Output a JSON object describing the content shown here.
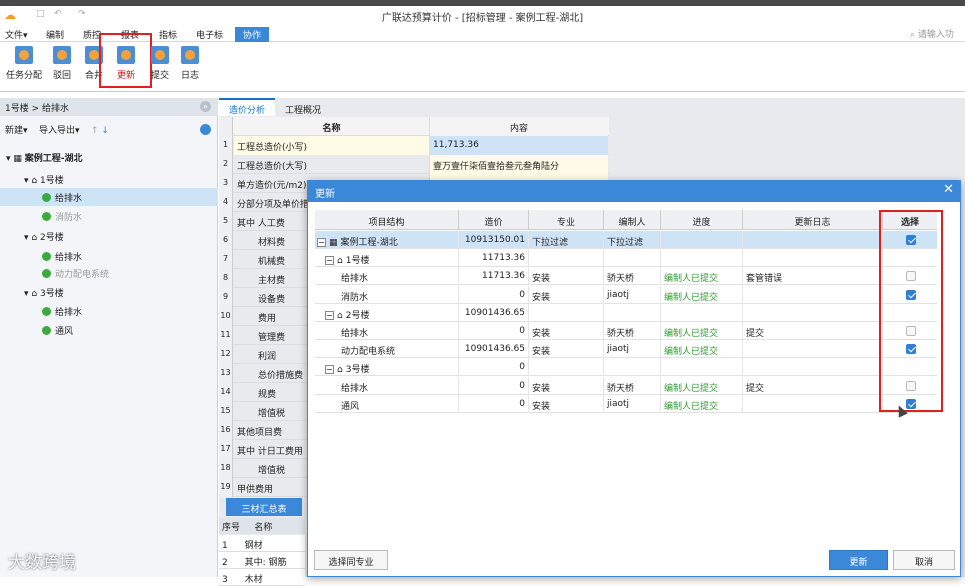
{
  "window": {
    "title": "广联达预算计价 - [招标管理 - 案例工程-湖北]"
  },
  "menubar": {
    "items": [
      "文件▾",
      "编制",
      "质控",
      "报表",
      "指标",
      "电子标",
      "协作"
    ],
    "active_index": 6,
    "search_placeholder": "请输入功"
  },
  "ribbon": {
    "buttons": [
      "任务分配",
      "驳回",
      "合并",
      "更新",
      "提交",
      "日志"
    ],
    "highlighted": "更新"
  },
  "left": {
    "breadcrumb": "1号楼 > 给排水",
    "toolbar": {
      "new": "新建▾",
      "import_export": "导入导出▾"
    },
    "tree": [
      {
        "label": "案例工程-湖北",
        "level": 0
      },
      {
        "label": "1号楼",
        "level": 1
      },
      {
        "label": "给排水",
        "level": 2,
        "selected": true
      },
      {
        "label": "消防水",
        "level": 2
      },
      {
        "label": "2号楼",
        "level": 1
      },
      {
        "label": "给排水",
        "level": 2
      },
      {
        "label": "动力配电系统",
        "level": 2
      },
      {
        "label": "3号楼",
        "level": 1
      },
      {
        "label": "给排水",
        "level": 2
      },
      {
        "label": "通风",
        "level": 2
      }
    ]
  },
  "main": {
    "tabs": [
      "造价分析",
      "工程概况"
    ],
    "sheet": {
      "headers": [
        "名称",
        "内容"
      ],
      "rows": [
        {
          "n": "1",
          "name": "工程总造价(小写)",
          "val": "11,713.36"
        },
        {
          "n": "2",
          "name": "工程总造价(大写)",
          "val": "壹万壹仟柒佰壹拾叁元叁角陆分"
        },
        {
          "n": "3",
          "name": "单方造价(元/m2)",
          "val": ""
        },
        {
          "n": "4",
          "name": "分部分项及单价措",
          "val": ""
        },
        {
          "n": "5",
          "name": "其中 人工费",
          "val": ""
        },
        {
          "n": "6",
          "name": "材料费",
          "val": ""
        },
        {
          "n": "7",
          "name": "机械费",
          "val": ""
        },
        {
          "n": "8",
          "name": "主材费",
          "val": ""
        },
        {
          "n": "9",
          "name": "设备费",
          "val": ""
        },
        {
          "n": "10",
          "name": "费用",
          "val": ""
        },
        {
          "n": "11",
          "name": "管理费",
          "val": ""
        },
        {
          "n": "12",
          "name": "利润",
          "val": ""
        },
        {
          "n": "13",
          "name": "总价措施费",
          "val": ""
        },
        {
          "n": "14",
          "name": "规费",
          "val": ""
        },
        {
          "n": "15",
          "name": "增值税",
          "val": ""
        },
        {
          "n": "16",
          "name": "其他项目费",
          "val": ""
        },
        {
          "n": "17",
          "name": "其中 计日工费用",
          "val": ""
        },
        {
          "n": "18",
          "name": "增值税",
          "val": ""
        },
        {
          "n": "19",
          "name": "甲供费用",
          "val": ""
        }
      ]
    },
    "bottom": {
      "tab": "三材汇总表",
      "headers": [
        "序号",
        "名称"
      ],
      "rows": [
        {
          "n": "1",
          "name": "钢材"
        },
        {
          "n": "2",
          "name": "其中: 钢筋"
        },
        {
          "n": "3",
          "name": "木材"
        }
      ]
    }
  },
  "dialog": {
    "title": "更新",
    "headers": [
      "项目结构",
      "造价",
      "专业",
      "编制人",
      "进度",
      "更新日志",
      "选择"
    ],
    "rows": [
      {
        "name": "案例工程-湖北",
        "cost": "10913150.01",
        "major": "下拉过滤",
        "editor": "下拉过滤",
        "progress": "",
        "log": "",
        "checked": true,
        "kind": "root"
      },
      {
        "name": "1号楼",
        "cost": "11713.36",
        "major": "",
        "editor": "",
        "progress": "",
        "log": "",
        "checked": null,
        "kind": "building"
      },
      {
        "name": "给排水",
        "cost": "11713.36",
        "major": "安装",
        "editor": "骄天桥",
        "progress": "编制人已提交",
        "log": "套管错误",
        "checked": false,
        "kind": "item"
      },
      {
        "name": "消防水",
        "cost": "0",
        "major": "安装",
        "editor": "jiaotj",
        "progress": "编制人已提交",
        "log": "",
        "checked": true,
        "kind": "item"
      },
      {
        "name": "2号楼",
        "cost": "10901436.65",
        "major": "",
        "editor": "",
        "progress": "",
        "log": "",
        "checked": null,
        "kind": "building"
      },
      {
        "name": "给排水",
        "cost": "0",
        "major": "安装",
        "editor": "骄天桥",
        "progress": "编制人已提交",
        "log": "提交",
        "checked": false,
        "kind": "item"
      },
      {
        "name": "动力配电系统",
        "cost": "10901436.65",
        "major": "安装",
        "editor": "jiaotj",
        "progress": "编制人已提交",
        "log": "",
        "checked": true,
        "kind": "item"
      },
      {
        "name": "3号楼",
        "cost": "0",
        "major": "",
        "editor": "",
        "progress": "",
        "log": "",
        "checked": null,
        "kind": "building"
      },
      {
        "name": "给排水",
        "cost": "0",
        "major": "安装",
        "editor": "骄天桥",
        "progress": "编制人已提交",
        "log": "提交",
        "checked": false,
        "kind": "item"
      },
      {
        "name": "通风",
        "cost": "0",
        "major": "安装",
        "editor": "jiaotj",
        "progress": "编制人已提交",
        "log": "",
        "checked": true,
        "kind": "item"
      }
    ],
    "buttons": {
      "same_major": "选择同专业",
      "update": "更新",
      "cancel": "取消"
    }
  },
  "watermark": "大数跨境",
  "colors": {
    "accent": "#3b88d8",
    "highlight_red": "#e02020",
    "status_green": "#2e9b2e"
  }
}
